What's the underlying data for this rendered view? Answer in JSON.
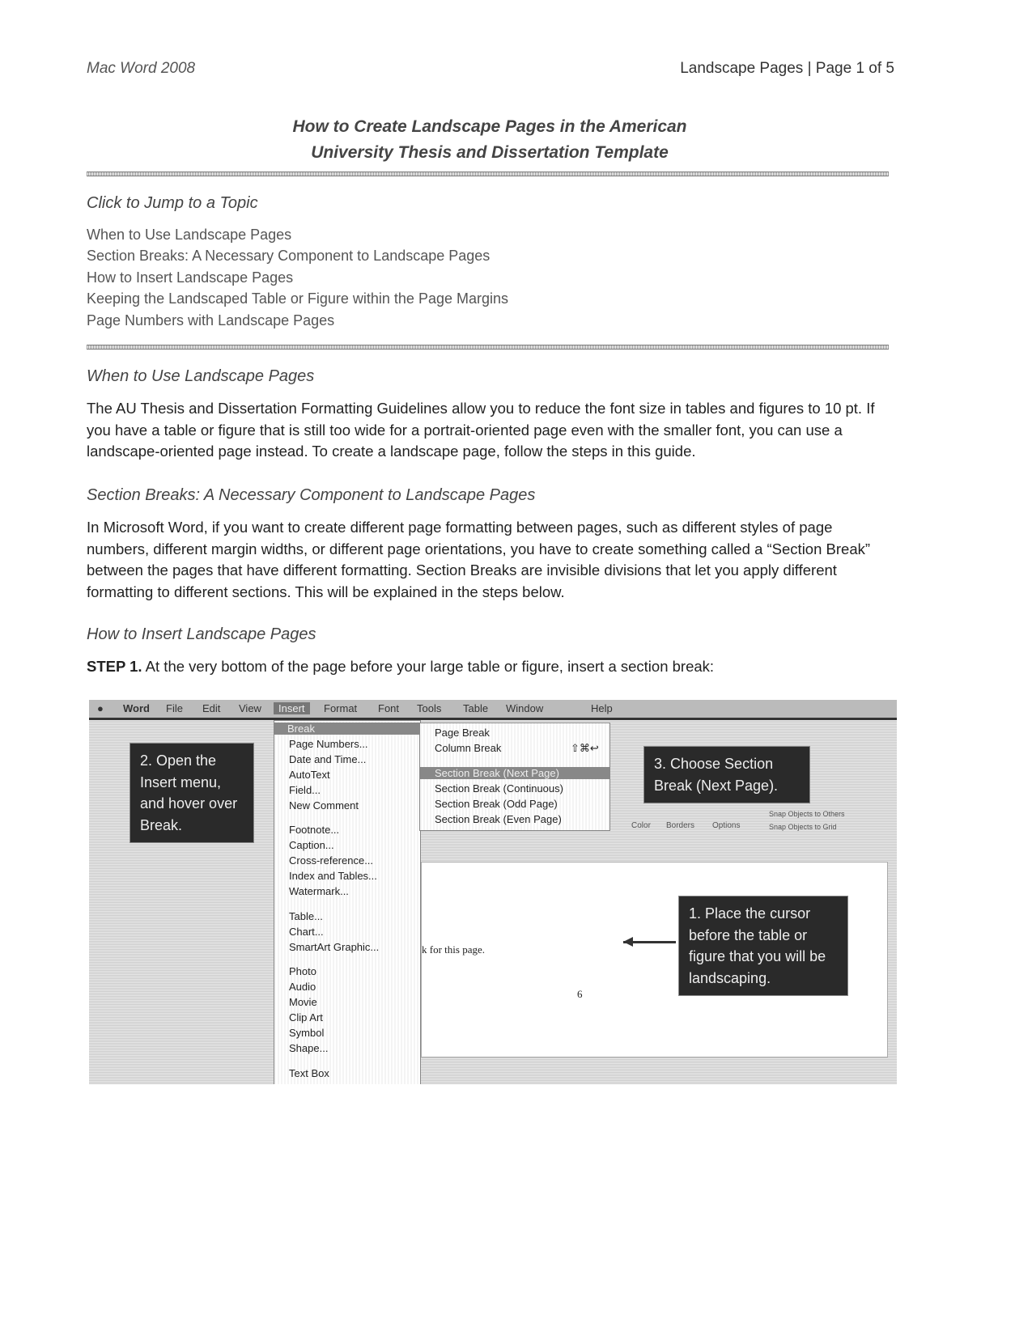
{
  "header": {
    "left": "Mac Word 2008",
    "right": "Landscape Pages | Page 1 of 5"
  },
  "title": [
    "How to Create Landscape Pages in the American",
    "University Thesis and Dissertation Template"
  ],
  "toc": {
    "heading": "Click to Jump to a Topic",
    "links": [
      "When to Use Landscape Pages",
      "Section Breaks: A Necessary Component to Landscape Pages",
      "How to Insert Landscape Pages",
      "Keeping the Landscaped Table or Figure within the Page Margins",
      "Page Numbers with Landscape Pages"
    ]
  },
  "sections": [
    {
      "heading": "When to Use Landscape Pages",
      "text": "The AU Thesis and Dissertation Formatting Guidelines allow you to reduce the font size in tables and figures to 10 pt. If you have a table or figure that is still too wide for a portrait-oriented page even with the smaller font, you can use a landscape-oriented page instead. To create a landscape page, follow the steps in this guide."
    },
    {
      "heading": "Section Breaks: A Necessary Component to Landscape Pages",
      "text": "In Microsoft Word, if you want to create different page formatting between pages, such as different styles of page numbers, different margin widths, or different page orientations, you have to create something called a “Section Break” between the pages that have different formatting. Section Breaks are invisible divisions that let you apply different formatting to different sections. This will be explained in the steps below."
    },
    {
      "heading": "How to Insert Landscape Pages",
      "step_label": "STEP 1.",
      "step_text": " At the very bottom of the page before your large table or figure, insert a section break:"
    }
  ],
  "screenshot": {
    "menubar": [
      "Word",
      "File",
      "Edit",
      "View",
      "Insert",
      "Format",
      "Font",
      "Tools",
      "Table",
      "Window",
      "Help"
    ],
    "insert_menu": [
      "Break",
      "Page Numbers...",
      "Date and Time...",
      "AutoText",
      "Field...",
      "New Comment",
      "Footnote...",
      "Caption...",
      "Cross-reference...",
      "Index and Tables...",
      "Watermark...",
      "Table...",
      "Chart...",
      "SmartArt Graphic...",
      "Photo",
      "Audio",
      "Movie",
      "Clip Art",
      "Symbol",
      "Shape...",
      "Text Box"
    ],
    "break_submenu": [
      "Page Break",
      "Column Break",
      "Section Break (Next Page)",
      "Section Break (Continuous)",
      "Section Break (Odd Page)",
      "Section Break (Even Page)"
    ],
    "column_break_shortcut": "⇧⌘↩",
    "callouts": [
      "2. Open the Insert menu, and hover over Break.",
      "3. Choose Section Break (Next Page).",
      "1. Place the cursor before the table or figure that you will be landscaping."
    ],
    "doc_text": "k for this page.",
    "page_number": "6",
    "ribbon_labels": [
      "Color",
      "Borders",
      "Options",
      "Snap Objects to Others",
      "Snap Objects to Grid"
    ]
  }
}
